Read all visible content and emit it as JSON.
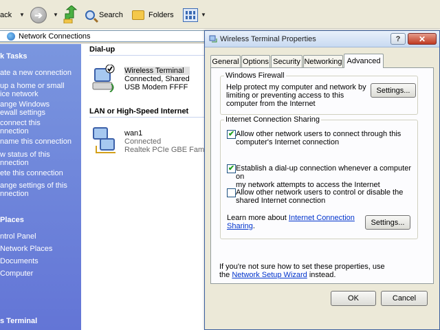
{
  "toolbar": {
    "back_label": "ack",
    "search_label": "Search",
    "folders_label": "Folders"
  },
  "address": {
    "value": "Network Connections"
  },
  "taskpane": {
    "network_tasks_header": "k Tasks",
    "tasks": [
      "ate a new connection",
      "up a home or small",
      "ice network",
      "ange Windows",
      "ewall settings",
      "connect this",
      "nnection",
      "name this connection",
      "w status of this",
      "nnection",
      "ete this connection",
      "ange settings of this",
      "nnection"
    ],
    "other_places_header": "Places",
    "places": [
      "ntrol Panel",
      "Network Places",
      "Documents",
      "Computer"
    ],
    "details_header": "s Terminal"
  },
  "content": {
    "dialup_header": "Dial-up",
    "dialup_conn": {
      "name": "Wireless Terminal",
      "status": "Connected, Shared",
      "device": "USB Modem FFFF"
    },
    "lan_header": "LAN or High-Speed Internet",
    "lan_conn": {
      "name": "wan1",
      "status": "Connected",
      "device": "Realtek PCIe GBE Family C"
    }
  },
  "dialog": {
    "title": "Wireless Terminal Properties",
    "help_label": "?",
    "close_label": "✕",
    "tabs": [
      "General",
      "Options",
      "Security",
      "Networking",
      "Advanced"
    ],
    "active_tab": "Advanced",
    "firewall": {
      "legend": "Windows Firewall",
      "text_lines": [
        "Help protect my computer and network by",
        "limiting or preventing access to this",
        "computer from the Internet"
      ],
      "settings_label": "Settings..."
    },
    "ics": {
      "legend": "Internet Connection Sharing",
      "options": [
        {
          "checked": true,
          "lines": [
            "Allow other network users to connect through this",
            "computer's Internet connection"
          ]
        },
        {
          "checked": true,
          "lines": [
            "Establish a dial-up connection whenever a computer on",
            "my network attempts to access the Internet"
          ]
        },
        {
          "checked": false,
          "lines": [
            "Allow other network users to control or disable the",
            "shared Internet connection"
          ]
        }
      ],
      "learn_prefix": "Learn more about ",
      "learn_link_1": "Internet Connection",
      "learn_link_2": "Sharing",
      "learn_suffix": ".",
      "settings_label": "Settings..."
    },
    "wizard": {
      "line1": "If you're not sure how to set these properties, use",
      "prefix": "the ",
      "link": "Network Setup Wizard",
      "suffix": " instead."
    },
    "ok_label": "OK",
    "cancel_label": "Cancel"
  }
}
